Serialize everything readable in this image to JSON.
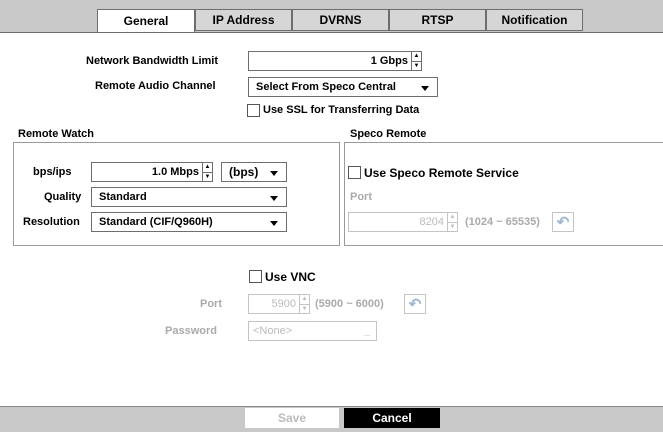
{
  "tabs": [
    "General",
    "IP Address",
    "DVRNS",
    "RTSP",
    "Notification"
  ],
  "general": {
    "bandwidth_label": "Network Bandwidth Limit",
    "bandwidth_value": "1 Gbps",
    "audio_label": "Remote Audio Channel",
    "audio_value": "Select From Speco Central",
    "ssl_label": "Use SSL for Transferring Data"
  },
  "remote_watch": {
    "title": "Remote Watch",
    "bps_label": "bps/ips",
    "bps_value": "1.0 Mbps",
    "bps_unit": "(bps)",
    "quality_label": "Quality",
    "quality_value": "Standard",
    "resolution_label": "Resolution",
    "resolution_value": "Standard (CIF/Q960H)"
  },
  "speco_remote": {
    "title": "Speco Remote",
    "use_label": "Use Speco Remote Service",
    "port_label": "Port",
    "port_value": "8204",
    "port_range": "(1024 ~ 65535)"
  },
  "vnc": {
    "use_label": "Use VNC",
    "port_label": "Port",
    "port_value": "5900",
    "port_range": "(5900 ~ 6000)",
    "password_label": "Password",
    "password_value": "<None>"
  },
  "footer": {
    "save_label": "Save",
    "cancel_label": "Cancel"
  }
}
